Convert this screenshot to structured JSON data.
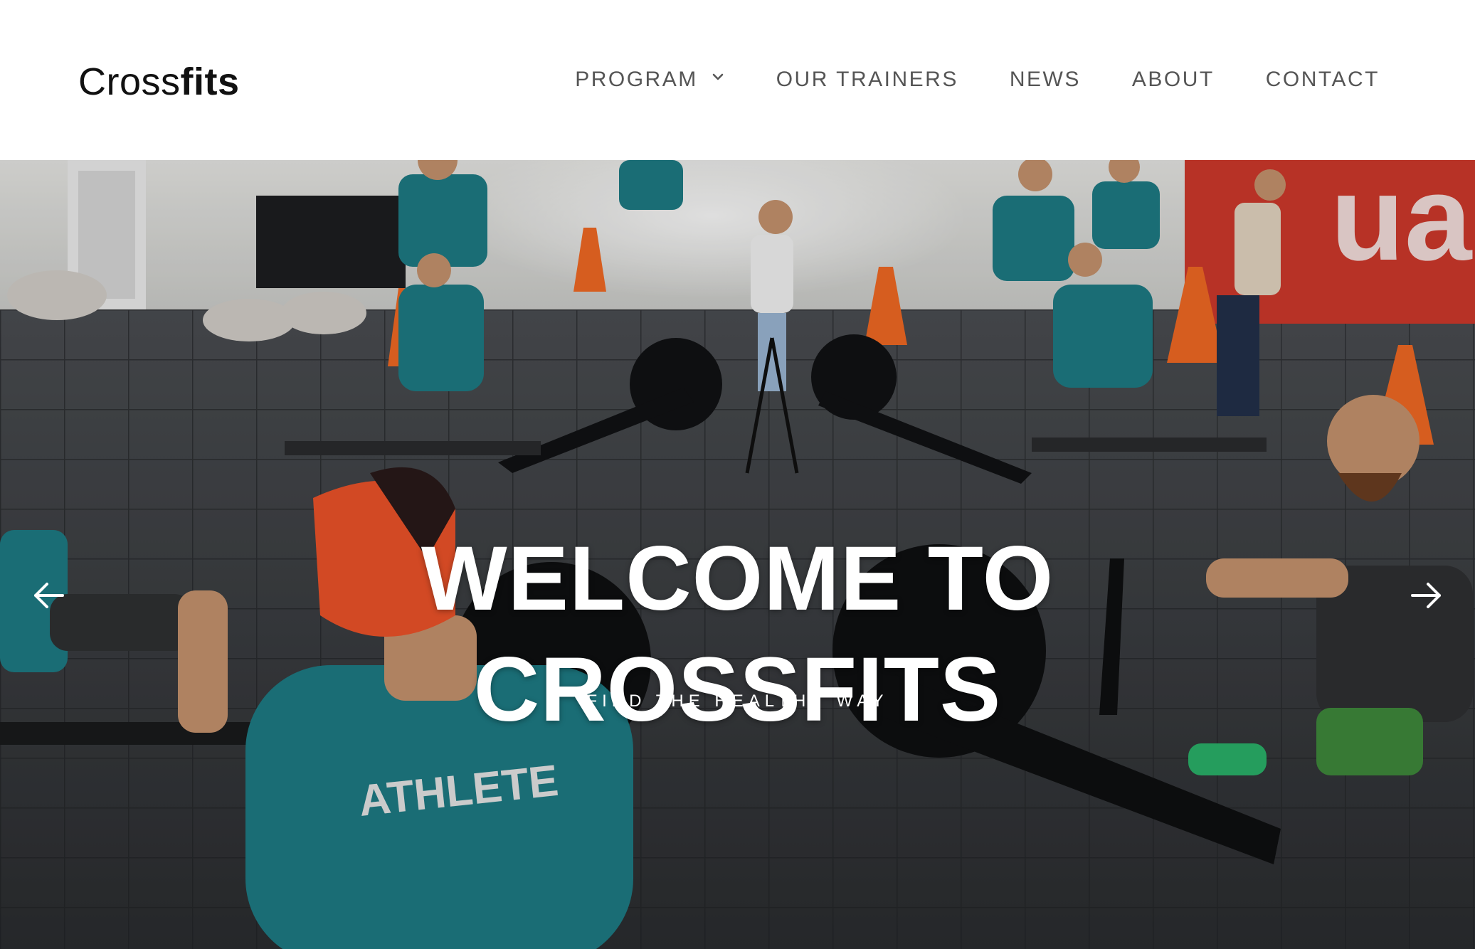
{
  "brand": {
    "logo_light": "Cross",
    "logo_bold": "fits"
  },
  "nav": {
    "items": [
      {
        "label": "PROGRAM",
        "has_dropdown": true
      },
      {
        "label": "OUR TRAINERS"
      },
      {
        "label": "NEWS"
      },
      {
        "label": "ABOUT"
      },
      {
        "label": "CONTACT"
      }
    ]
  },
  "hero": {
    "title_line1": "WELCOME TO",
    "title_line2": "CROSSFITS",
    "subtitle": "FIND THE HEALTHY WAY",
    "prev_icon": "arrow-left-icon",
    "next_icon": "arrow-right-icon",
    "photo_description": ""
  },
  "colors": {
    "nav_text": "#555555",
    "logo_text": "#111111",
    "hero_text": "#ffffff",
    "shirt_teal": "#1e7d86",
    "cap_orange": "#f0542a"
  }
}
